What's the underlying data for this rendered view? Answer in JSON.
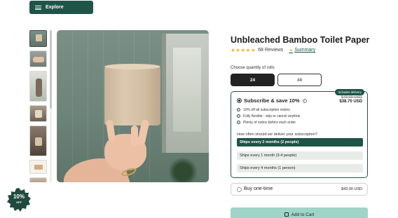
{
  "nav": {
    "explore_label": "Explore"
  },
  "product": {
    "title": "Unbleached Bamboo Toilet Paper",
    "stars": "★★★★★",
    "reviews": "68 Reviews",
    "summary_label": "Summary"
  },
  "quantity": {
    "label": "Choose quantity of rolls",
    "options": [
      {
        "label": "24",
        "selected": true
      },
      {
        "label": "48",
        "selected": false
      }
    ]
  },
  "subscription": {
    "badge": "Includes delivery",
    "title": "Subscribe & save 10%",
    "price_old": "$43.00 USD",
    "price_new": "$38.70 USD",
    "benefits": [
      "10% off all subscription orders",
      "Fully flexible - skip or cancel anytime",
      "Plenty of notice before each order"
    ],
    "question": "How often should we deliver your subscription?",
    "frequencies": [
      {
        "label": "Ships every 2 months (2 people)",
        "selected": true
      },
      {
        "label": "Ships every 1 month (3-4 people)",
        "selected": false
      },
      {
        "label": "Ships every 4 months (1 person)",
        "selected": false
      }
    ]
  },
  "one_time": {
    "label": "Buy one-time",
    "price": "$43.00 USD"
  },
  "cart": {
    "label": "Add to Cart"
  },
  "promo": {
    "value": "10%",
    "sub": "OFF"
  },
  "colors": {
    "brand": "#1f5448",
    "cart": "#9fd5c9",
    "stars": "#f0b429"
  }
}
